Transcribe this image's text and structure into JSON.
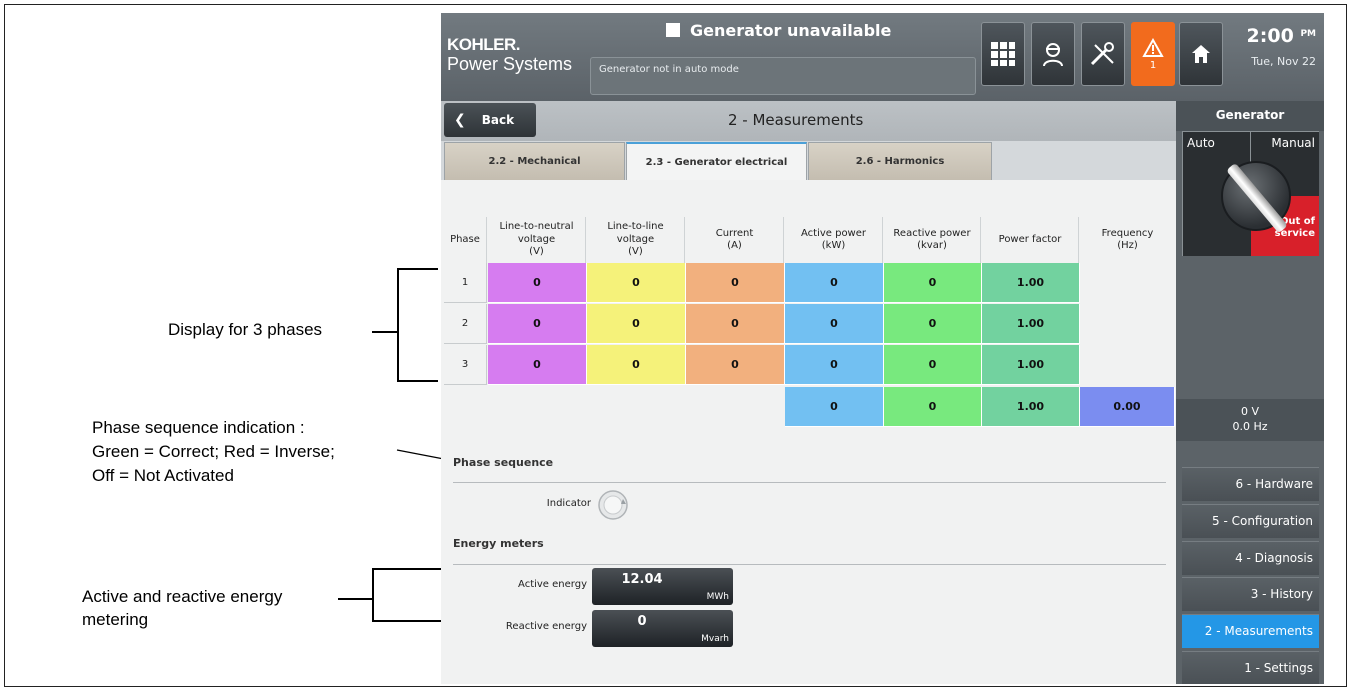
{
  "callouts": {
    "phases": "Display for 3 phases",
    "phase_seq_1": "Phase sequence indication :",
    "phase_seq_2": "Green = Correct; Red = Inverse;",
    "phase_seq_3": "Off = Not Activated",
    "energy_1": "Active and reactive energy",
    "energy_2": "metering"
  },
  "header": {
    "logo_brand": "KOHLER.",
    "logo_sub": "Power Systems",
    "status": "Generator unavailable",
    "message": "Generator not in auto mode",
    "alarm_count": "1",
    "time": "2:00",
    "ampm": "PM",
    "date": "Tue, Nov 22",
    "icons": [
      "grid-icon",
      "technician-icon",
      "tools-icon",
      "alarm-icon",
      "home-icon"
    ]
  },
  "nav": {
    "back": "Back",
    "title": "2 - Measurements"
  },
  "tabs": [
    {
      "label": "2.2 - Mechanical",
      "active": false
    },
    {
      "label": "2.3 - Generator electrical",
      "active": true
    },
    {
      "label": "2.6 - Harmonics",
      "active": false
    }
  ],
  "table": {
    "headers": {
      "phase": "Phase",
      "lnv": [
        "Line-to-neutral",
        "voltage",
        "(V)"
      ],
      "llv": [
        "Line-to-line",
        "voltage",
        "(V)"
      ],
      "cur": [
        "Current",
        "(A)"
      ],
      "ap": [
        "Active power",
        "(kW)"
      ],
      "rp": [
        "Reactive power",
        "(kvar)"
      ],
      "pf": [
        "Power factor"
      ],
      "hz": [
        "Frequency",
        "(Hz)"
      ]
    },
    "rows": [
      {
        "phase": "1",
        "lnv": "0",
        "llv": "0",
        "cur": "0",
        "ap": "0",
        "rp": "0",
        "pf": "1.00"
      },
      {
        "phase": "2",
        "lnv": "0",
        "llv": "0",
        "cur": "0",
        "ap": "0",
        "rp": "0",
        "pf": "1.00"
      },
      {
        "phase": "3",
        "lnv": "0",
        "llv": "0",
        "cur": "0",
        "ap": "0",
        "rp": "0",
        "pf": "1.00"
      }
    ],
    "totals": {
      "ap": "0",
      "rp": "0",
      "pf": "1.00",
      "hz": "0.00"
    }
  },
  "phase_sequence": {
    "title": "Phase sequence",
    "indicator_label": "Indicator"
  },
  "energy": {
    "title": "Energy meters",
    "active_label": "Active energy",
    "active_value": "12.04",
    "active_unit": "MWh",
    "reactive_label": "Reactive energy",
    "reactive_value": "0",
    "reactive_unit": "Mvarh"
  },
  "side": {
    "title": "Generator",
    "auto": "Auto",
    "manual": "Manual",
    "oos_1": "Out of",
    "oos_2": "service",
    "volts": "0 V",
    "hz": "0.0 Hz",
    "menu": [
      {
        "label": "6 - Hardware",
        "active": false
      },
      {
        "label": "5 - Configuration",
        "active": false
      },
      {
        "label": "4 - Diagnosis",
        "active": false
      },
      {
        "label": "3 - History",
        "active": false
      },
      {
        "label": "2 - Measurements",
        "active": true
      },
      {
        "label": "1 - Settings",
        "active": false
      }
    ]
  },
  "colors": {
    "accent": "#2497e6",
    "alarm": "#f26b1d",
    "out_of_service": "#d8202a"
  }
}
